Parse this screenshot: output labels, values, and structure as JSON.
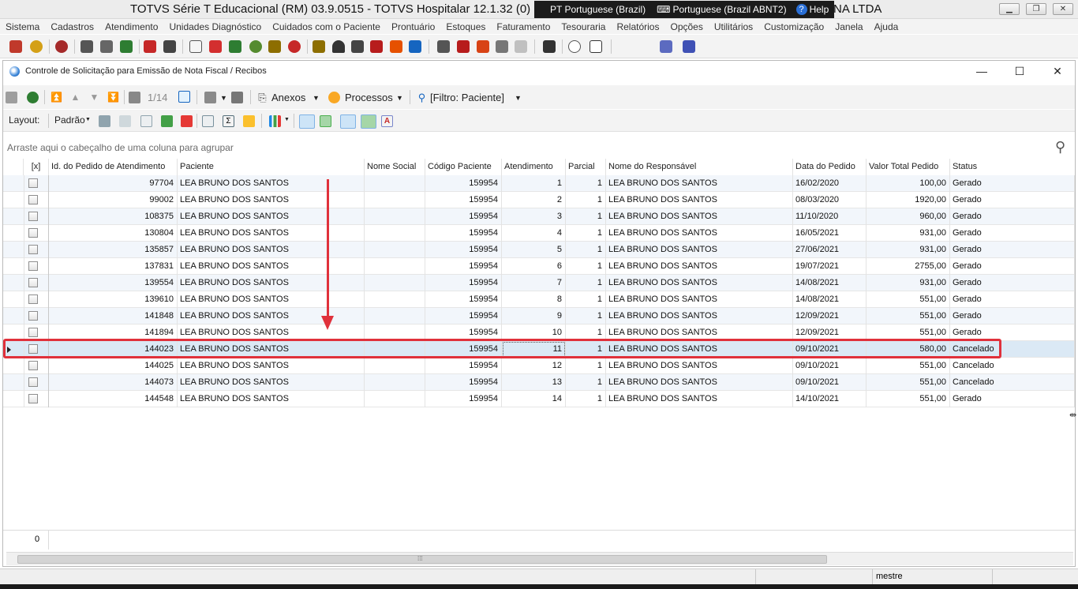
{
  "window": {
    "title": "TOTVS Série T Educacional (RM) 03.9.0515 - TOTVS Hospitalar 12.1.32 (0) | Al",
    "title_tail": "NA LTDA",
    "lang1": "PT Portuguese (Brazil)",
    "lang2": "Portuguese (Brazil ABNT2)",
    "help": "Help"
  },
  "menu": [
    "Sistema",
    "Cadastros",
    "Atendimento",
    "Unidades Diagnóstico",
    "Cuidados com o Paciente",
    "Prontuário",
    "Estoques",
    "Faturamento",
    "Tesouraria",
    "Relatórios",
    "Opções",
    "Utilitários",
    "Customização",
    "Janela",
    "Ajuda"
  ],
  "inner": {
    "title": "Controle de Solicitação para Emissão de Nota Fiscal / Recibos",
    "record_counter": "1/14",
    "anexos_label": "Anexos",
    "processos_label": "Processos",
    "filtro_label": "[Filtro: Paciente]",
    "layout_label": "Layout:",
    "layout_value": "Padrão",
    "group_hint": "Arraste aqui o cabeçalho de uma coluna para agrupar",
    "footer_count": "0"
  },
  "grid": {
    "columns": [
      "[x]",
      "Id. do Pedido de Atendimento",
      "Paciente",
      "Nome Social",
      "Código Paciente",
      "Atendimento",
      "Parcial",
      "Nome do Responsável",
      "Data do Pedido",
      "Valor Total Pedido",
      "Status"
    ],
    "rows": [
      {
        "id": "97704",
        "paciente": "LEA BRUNO DOS SANTOS",
        "nome_social": "",
        "codigo": "159954",
        "atendimento": "1",
        "parcial": "1",
        "responsavel": "LEA BRUNO DOS SANTOS",
        "data": "16/02/2020",
        "valor": "100,00",
        "status": "Gerado"
      },
      {
        "id": "99002",
        "paciente": "LEA BRUNO DOS SANTOS",
        "nome_social": "",
        "codigo": "159954",
        "atendimento": "2",
        "parcial": "1",
        "responsavel": "LEA BRUNO DOS SANTOS",
        "data": "08/03/2020",
        "valor": "1920,00",
        "status": "Gerado"
      },
      {
        "id": "108375",
        "paciente": "LEA BRUNO DOS SANTOS",
        "nome_social": "",
        "codigo": "159954",
        "atendimento": "3",
        "parcial": "1",
        "responsavel": "LEA BRUNO DOS SANTOS",
        "data": "11/10/2020",
        "valor": "960,00",
        "status": "Gerado"
      },
      {
        "id": "130804",
        "paciente": "LEA BRUNO DOS SANTOS",
        "nome_social": "",
        "codigo": "159954",
        "atendimento": "4",
        "parcial": "1",
        "responsavel": "LEA BRUNO DOS SANTOS",
        "data": "16/05/2021",
        "valor": "931,00",
        "status": "Gerado"
      },
      {
        "id": "135857",
        "paciente": "LEA BRUNO DOS SANTOS",
        "nome_social": "",
        "codigo": "159954",
        "atendimento": "5",
        "parcial": "1",
        "responsavel": "LEA BRUNO DOS SANTOS",
        "data": "27/06/2021",
        "valor": "931,00",
        "status": "Gerado"
      },
      {
        "id": "137831",
        "paciente": "LEA BRUNO DOS SANTOS",
        "nome_social": "",
        "codigo": "159954",
        "atendimento": "6",
        "parcial": "1",
        "responsavel": "LEA BRUNO DOS SANTOS",
        "data": "19/07/2021",
        "valor": "2755,00",
        "status": "Gerado"
      },
      {
        "id": "139554",
        "paciente": "LEA BRUNO DOS SANTOS",
        "nome_social": "",
        "codigo": "159954",
        "atendimento": "7",
        "parcial": "1",
        "responsavel": "LEA BRUNO DOS SANTOS",
        "data": "14/08/2021",
        "valor": "931,00",
        "status": "Gerado"
      },
      {
        "id": "139610",
        "paciente": "LEA BRUNO DOS SANTOS",
        "nome_social": "",
        "codigo": "159954",
        "atendimento": "8",
        "parcial": "1",
        "responsavel": "LEA BRUNO DOS SANTOS",
        "data": "14/08/2021",
        "valor": "551,00",
        "status": "Gerado"
      },
      {
        "id": "141848",
        "paciente": "LEA BRUNO DOS SANTOS",
        "nome_social": "",
        "codigo": "159954",
        "atendimento": "9",
        "parcial": "1",
        "responsavel": "LEA BRUNO DOS SANTOS",
        "data": "12/09/2021",
        "valor": "551,00",
        "status": "Gerado"
      },
      {
        "id": "141894",
        "paciente": "LEA BRUNO DOS SANTOS",
        "nome_social": "",
        "codigo": "159954",
        "atendimento": "10",
        "parcial": "1",
        "responsavel": "LEA BRUNO DOS SANTOS",
        "data": "12/09/2021",
        "valor": "551,00",
        "status": "Gerado"
      },
      {
        "id": "144023",
        "paciente": "LEA BRUNO DOS SANTOS",
        "nome_social": "",
        "codigo": "159954",
        "atendimento": "11",
        "parcial": "1",
        "responsavel": "LEA BRUNO DOS SANTOS",
        "data": "09/10/2021",
        "valor": "580,00",
        "status": "Cancelado"
      },
      {
        "id": "144025",
        "paciente": "LEA BRUNO DOS SANTOS",
        "nome_social": "",
        "codigo": "159954",
        "atendimento": "12",
        "parcial": "1",
        "responsavel": "LEA BRUNO DOS SANTOS",
        "data": "09/10/2021",
        "valor": "551,00",
        "status": "Cancelado"
      },
      {
        "id": "144073",
        "paciente": "LEA BRUNO DOS SANTOS",
        "nome_social": "",
        "codigo": "159954",
        "atendimento": "13",
        "parcial": "1",
        "responsavel": "LEA BRUNO DOS SANTOS",
        "data": "09/10/2021",
        "valor": "551,00",
        "status": "Cancelado"
      },
      {
        "id": "144548",
        "paciente": "LEA BRUNO DOS SANTOS",
        "nome_social": "",
        "codigo": "159954",
        "atendimento": "14",
        "parcial": "1",
        "responsavel": "LEA BRUNO DOS SANTOS",
        "data": "14/10/2021",
        "valor": "551,00",
        "status": "Gerado"
      }
    ]
  },
  "status": {
    "user": "mestre"
  },
  "colors": {
    "highlight": "#e0313b",
    "selected_row": "#dbe9f5"
  }
}
